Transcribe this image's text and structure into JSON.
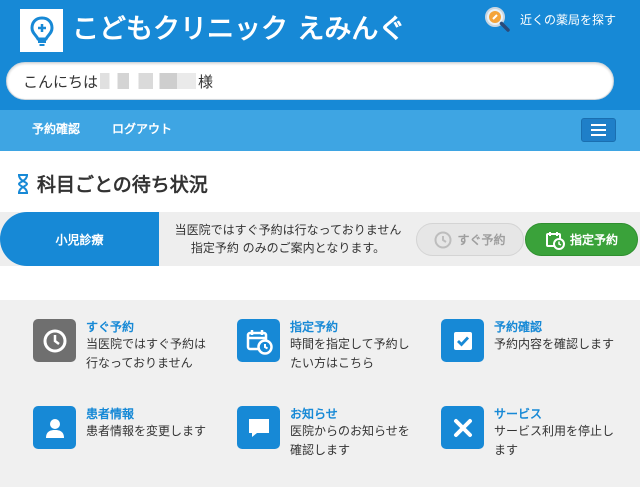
{
  "header": {
    "logo_text": "こどもクリニック えみんぐ",
    "pharmacy_label": "近くの薬局を探す"
  },
  "greeting": {
    "prefix": "こんにちは",
    "suffix": "様"
  },
  "nav": {
    "items": [
      {
        "label": "予約確認"
      },
      {
        "label": "ログアウト"
      }
    ]
  },
  "section": {
    "title": "科目ごとの待ち状況"
  },
  "wait": {
    "department": "小児診療",
    "message_line1": "当医院ではすぐ予約は行なっておりません",
    "message_line2": "指定予約 のみのご案内となります。",
    "immediate_button": "すぐ予約",
    "appoint_button": "指定予約"
  },
  "tiles": [
    {
      "title": "すぐ予約",
      "desc": "当医院ではすぐ予約は行なっておりません",
      "icon": "clock-icon"
    },
    {
      "title": "指定予約",
      "desc": "時間を指定して予約したい方はこちら",
      "icon": "calendar-clock-icon"
    },
    {
      "title": "予約確認",
      "desc": "予約内容を確認します",
      "icon": "checkbox-icon"
    },
    {
      "title": "患者情報",
      "desc": "患者情報を変更します",
      "icon": "user-icon"
    },
    {
      "title": "お知らせ",
      "desc": "医院からのお知らせを確認します",
      "icon": "speech-bubble-icon"
    },
    {
      "title": "サービス",
      "desc": "サービス利用を停止します",
      "icon": "close-x-icon"
    }
  ],
  "colors": {
    "primary": "#1789d6",
    "nav": "#3ea5e3",
    "green": "#3aa23a",
    "gray_icon": "#6f6f6f"
  }
}
